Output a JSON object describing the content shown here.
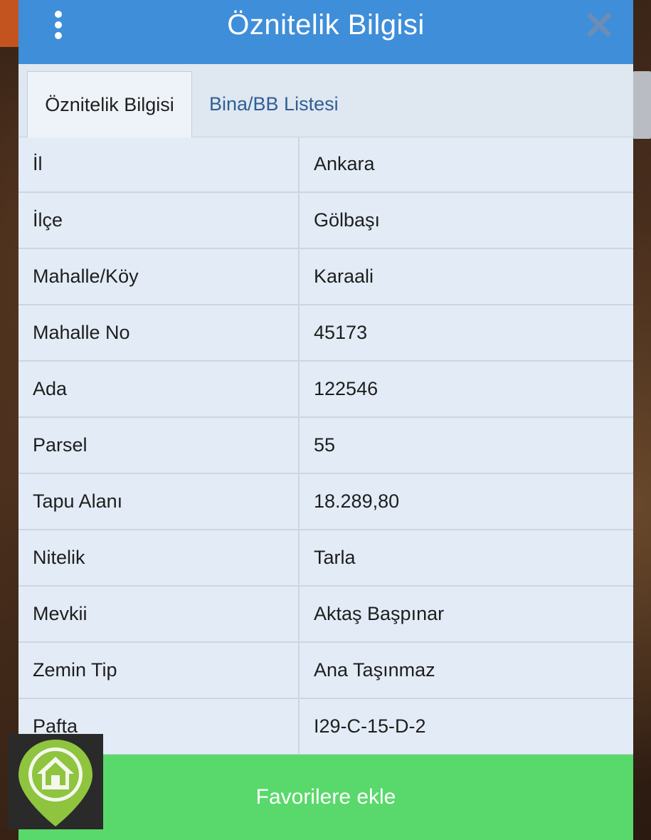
{
  "header": {
    "title": "Öznitelik Bilgisi",
    "menu_icon": "more-vertical-icon",
    "close_icon": "close-icon"
  },
  "tabs": [
    {
      "label": "Öznitelik Bilgisi",
      "active": true
    },
    {
      "label": "Bina/BB Listesi",
      "active": false
    }
  ],
  "attributes": [
    {
      "label": "İl",
      "value": "Ankara"
    },
    {
      "label": "İlçe",
      "value": "Gölbaşı"
    },
    {
      "label": "Mahalle/Köy",
      "value": "Karaali"
    },
    {
      "label": "Mahalle No",
      "value": "45173"
    },
    {
      "label": "Ada",
      "value": "122546"
    },
    {
      "label": "Parsel",
      "value": "55"
    },
    {
      "label": "Tapu Alanı",
      "value": "18.289,80"
    },
    {
      "label": "Nitelik",
      "value": "Tarla"
    },
    {
      "label": "Mevkii",
      "value": "Aktaş Başpınar"
    },
    {
      "label": "Zemin Tip",
      "value": "Ana Taşınmaz"
    },
    {
      "label": "Pafta",
      "value": "I29-C-15-D-2"
    }
  ],
  "footer": {
    "favorite_label": "Favorilere ekle"
  },
  "colors": {
    "header": "#3f8ed9",
    "favorite_button": "#59d96b",
    "panel_background": "#e3ecf6",
    "inactive_tab_text": "#2f5f95"
  },
  "icons": {
    "logo": "home-pin-logo"
  }
}
